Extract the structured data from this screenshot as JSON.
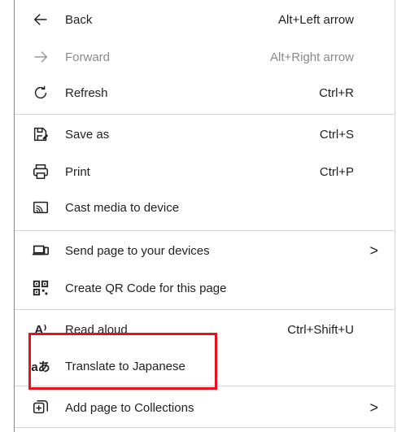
{
  "menu": {
    "items": [
      {
        "label": "Back",
        "shortcut": "Alt+Left arrow"
      },
      {
        "label": "Forward",
        "shortcut": "Alt+Right arrow"
      },
      {
        "label": "Refresh",
        "shortcut": "Ctrl+R"
      },
      {
        "label": "Save as",
        "shortcut": "Ctrl+S"
      },
      {
        "label": "Print",
        "shortcut": "Ctrl+P"
      },
      {
        "label": "Cast media to device",
        "shortcut": ""
      },
      {
        "label": "Send page to your devices",
        "shortcut": ""
      },
      {
        "label": "Create QR Code for this page",
        "shortcut": ""
      },
      {
        "label": "Read aloud",
        "shortcut": "Ctrl+Shift+U"
      },
      {
        "label": "Translate to Japanese",
        "shortcut": ""
      },
      {
        "label": "Add page to Collections",
        "shortcut": ""
      }
    ],
    "chevron": ">",
    "read_aloud_icon": "A⁾",
    "translate_icon": "aあ"
  },
  "colors": {
    "highlight": "#e8101a",
    "text": "#1f1f1f",
    "disabled": "#8a8a8a"
  }
}
